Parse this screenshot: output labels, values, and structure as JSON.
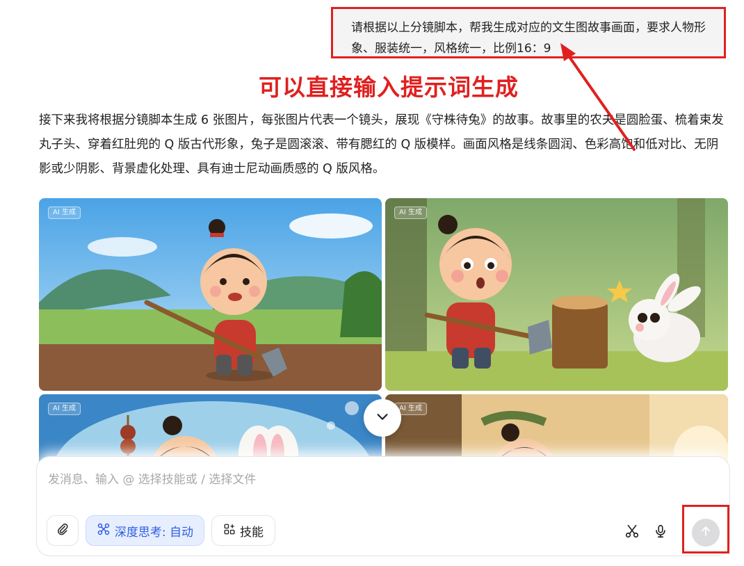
{
  "user_message": {
    "text": "请根据以上分镜脚本，帮我生成对应的文生图故事画面，要求人物形象、服装统一，风格统一，比例16：9"
  },
  "annotation": {
    "title": "可以直接输入提示词生成",
    "color": "#e02020"
  },
  "assistant_reply": {
    "text": "接下来我将根据分镜脚本生成 6 张图片，每张图片代表一个镜头，展现《守株待兔》的故事。故事里的农夫是圆脸蛋、梳着束发丸子头、穿着红肚兜的 Q 版古代形象，兔子是圆滚滚、带有腮红的 Q 版模样。画面风格是线条圆润、色彩高饱和低对比、无阴影或少阴影、背景虚化处理、具有迪士尼动画质感的 Q 版风格。"
  },
  "images": [
    {
      "badge": "AI 生成",
      "scene": "farmer-digging-field"
    },
    {
      "badge": "AI 生成",
      "scene": "rabbit-runs-to-stump"
    },
    {
      "badge": "AI 生成",
      "scene": "farmer-dreaming-of-food"
    },
    {
      "badge": "AI 生成",
      "scene": "farmer-waiting-by-tree"
    }
  ],
  "composer": {
    "placeholder": "发消息、输入 @ 选择技能或 / 选择文件",
    "attach_icon": "paperclip-icon",
    "deep_think_label": "深度思考: 自动",
    "skills_label": "技能",
    "scissors_icon": "scissors-icon",
    "mic_icon": "microphone-icon",
    "send_icon": "arrow-up-icon"
  },
  "colors": {
    "accent_blue": "#2f5de0",
    "annotation_red": "#e02020"
  }
}
